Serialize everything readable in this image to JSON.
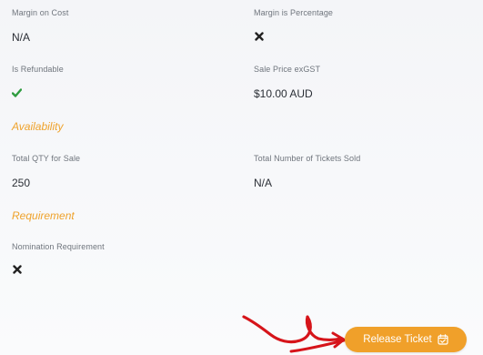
{
  "fields": {
    "margin_on_cost": {
      "label": "Margin on Cost",
      "value": "N/A"
    },
    "margin_is_percentage": {
      "label": "Margin is Percentage",
      "icon": "cross-icon"
    },
    "is_refundable": {
      "label": "Is Refundable",
      "icon": "check-icon"
    },
    "sale_price": {
      "label": "Sale Price exGST",
      "value": "$10.00 AUD"
    },
    "total_qty": {
      "label": "Total QTY for Sale",
      "value": "250"
    },
    "total_sold": {
      "label": "Total Number of Tickets Sold",
      "value": "N/A"
    },
    "nomination_requirement": {
      "label": "Nomination Requirement",
      "icon": "cross-icon"
    }
  },
  "sections": {
    "availability": "Availability",
    "requirement": "Requirement"
  },
  "actions": {
    "release_ticket_label": "Release Ticket",
    "release_ticket_icon": "calendar-check-icon"
  },
  "colors": {
    "accent": "#f0a02a",
    "check": "#2e9c3f",
    "cross": "#222222",
    "annotation": "#d6141a"
  }
}
